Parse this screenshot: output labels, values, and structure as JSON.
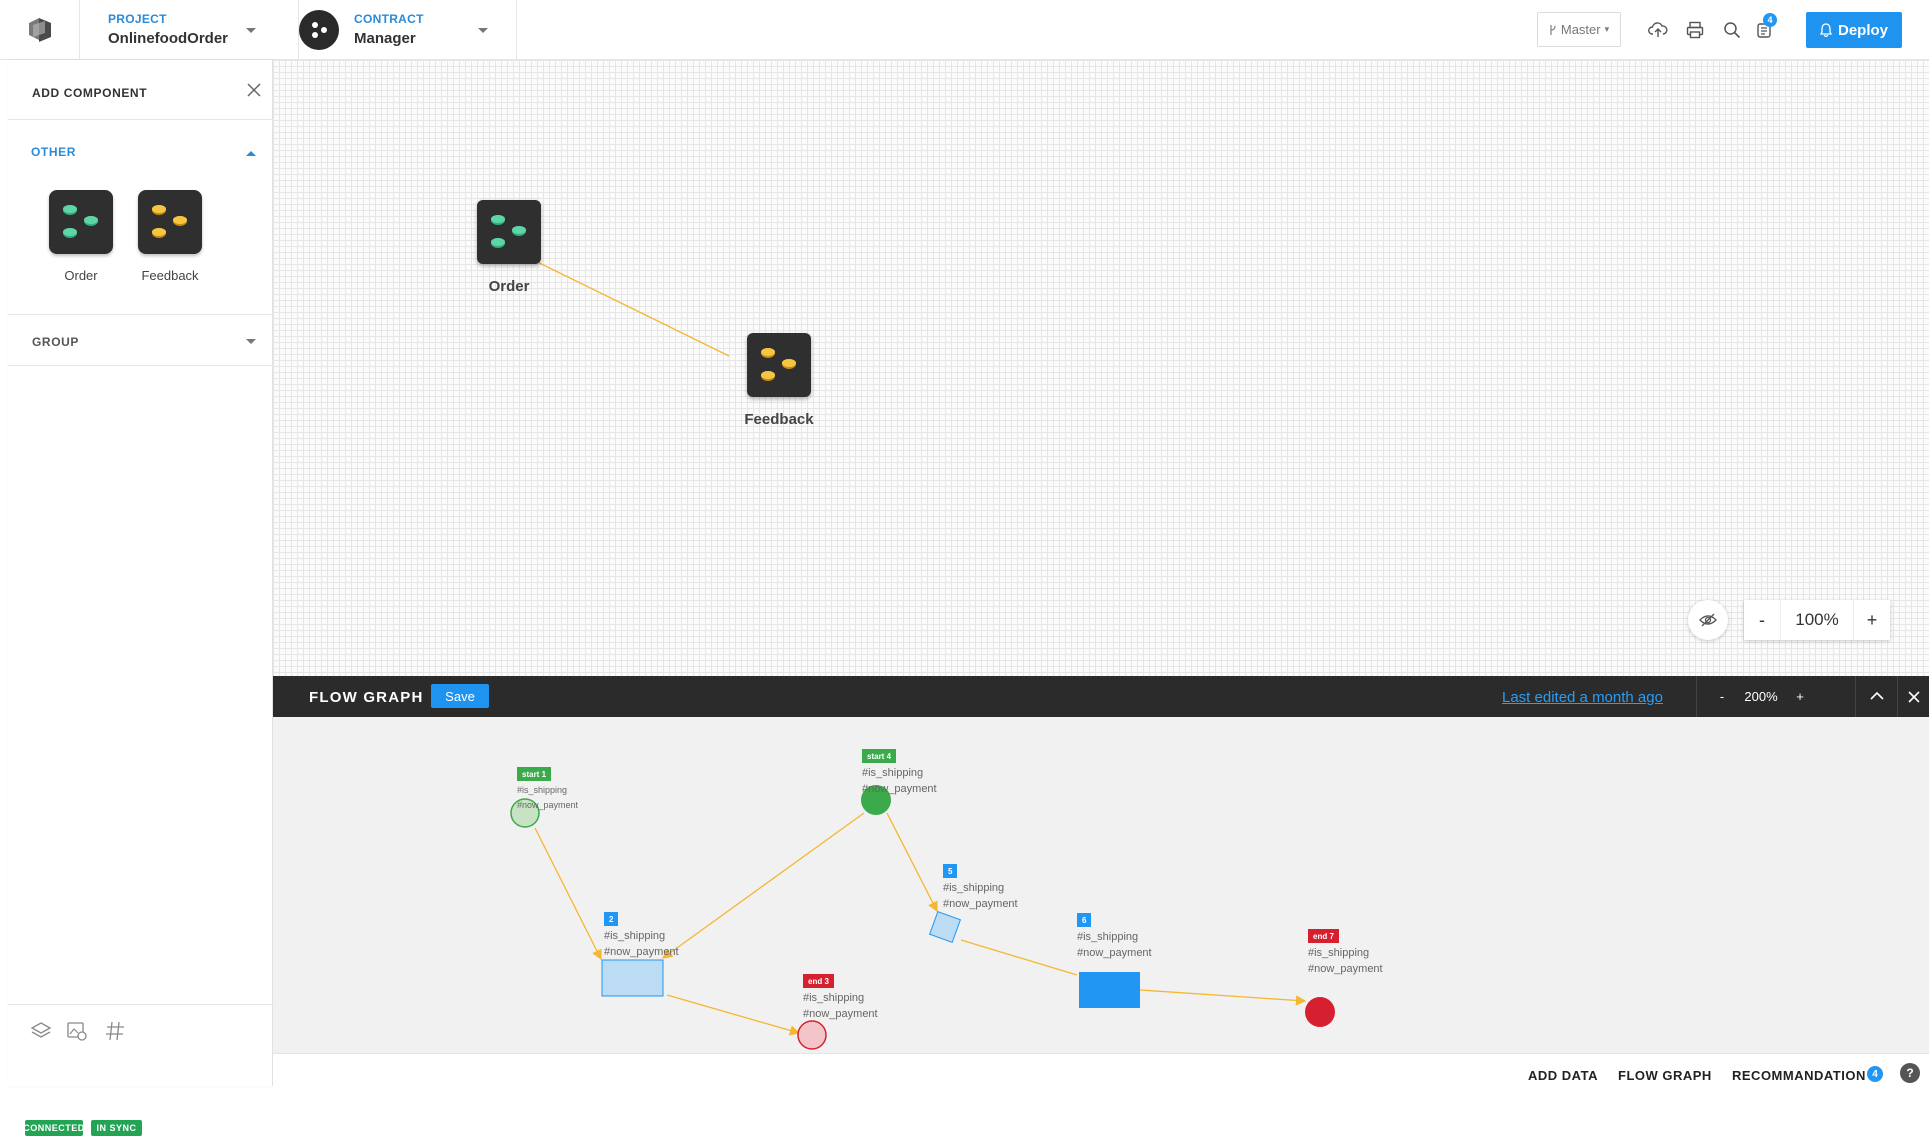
{
  "header": {
    "project_caption": "PROJECT",
    "project_name": "OnlinefoodOrder",
    "contract_caption": "CONTRACT",
    "contract_name": "Manager",
    "branch_label": "Master",
    "notification_count": "4",
    "deploy_label": "Deploy"
  },
  "sidebar": {
    "title": "ADD COMPONENT",
    "other_section": "OTHER",
    "group_section": "GROUP",
    "components": [
      {
        "label": "Order"
      },
      {
        "label": "Feedback"
      }
    ],
    "status": {
      "connected": "CONNECTED",
      "sync": "IN SYNC"
    }
  },
  "canvas": {
    "nodes": [
      {
        "label": "Order"
      },
      {
        "label": "Feedback"
      }
    ],
    "zoom": {
      "minus": "-",
      "value": "100%",
      "plus": "+"
    }
  },
  "flow_graph": {
    "title": "FLOW GRAPH",
    "save_label": "Save",
    "last_edited": "Last edited a month ago",
    "zoom": {
      "minus": "-",
      "value": "200%",
      "plus": "+"
    },
    "nodes": [
      {
        "tag": "start 1",
        "line1": "#is_shipping",
        "line2": "#now_payment"
      },
      {
        "tag": "2",
        "line1": "#is_shipping",
        "line2": "#now_payment"
      },
      {
        "tag": "end 3",
        "line1": "#is_shipping",
        "line2": "#now_payment"
      },
      {
        "tag": "start 4",
        "line1": "#is_shipping",
        "line2": "#now_payment"
      },
      {
        "tag": "5",
        "line1": "#is_shipping",
        "line2": "#now_payment"
      },
      {
        "tag": "6",
        "line1": "#is_shipping",
        "line2": "#now_payment"
      },
      {
        "tag": "end 7",
        "line1": "#is_shipping",
        "line2": "#now_payment"
      }
    ],
    "colors": {
      "start": "#3aaa4a",
      "task": "#2196f3",
      "end": "#d6202f",
      "edge": "#f5b731"
    }
  },
  "bottom_bar": {
    "add_data": "ADD DATA",
    "flow_graph": "FLOW GRAPH",
    "recommendation": "RECOMMANDATION",
    "recommendation_count": "4",
    "help": "?"
  }
}
